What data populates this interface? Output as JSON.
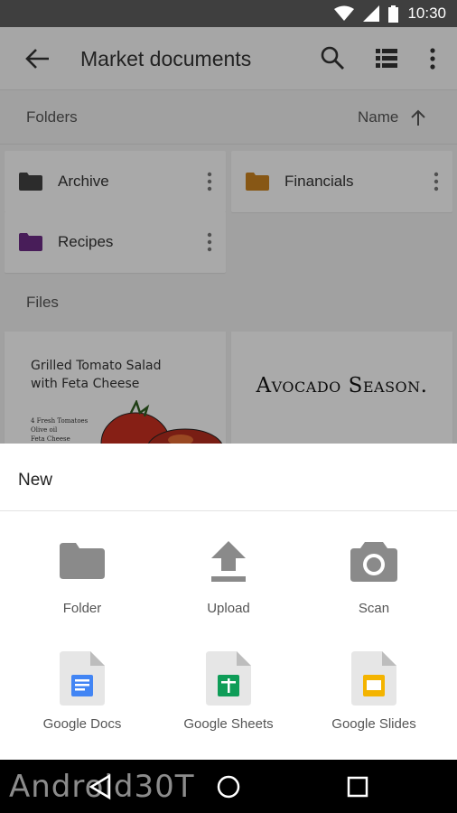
{
  "status_bar": {
    "time": "10:30"
  },
  "app_bar": {
    "title": "Market documents"
  },
  "subheader": {
    "label": "Folders",
    "sort_label": "Name"
  },
  "folders": [
    {
      "name": "Archive",
      "color": "#424242"
    },
    {
      "name": "Financials",
      "color": "#c8811f"
    },
    {
      "name": "Recipes",
      "color": "#6a2b83"
    }
  ],
  "files_label": "Files",
  "files": [
    {
      "title_line1": "Grilled Tomato Salad",
      "title_line2": "with Feta Cheese",
      "ingredients": [
        "4 Fresh Tomatoes",
        "Olive oil",
        "Feta Cheese"
      ]
    },
    {
      "title": "Avocado Season."
    }
  ],
  "sheet": {
    "title": "New",
    "options": [
      {
        "label": "Folder",
        "icon": "folder-icon"
      },
      {
        "label": "Upload",
        "icon": "upload-icon"
      },
      {
        "label": "Scan",
        "icon": "camera-icon"
      },
      {
        "label": "Google Docs",
        "icon": "google-docs-icon"
      },
      {
        "label": "Google Sheets",
        "icon": "google-sheets-icon"
      },
      {
        "label": "Google Slides",
        "icon": "google-slides-icon"
      }
    ]
  },
  "watermark": "Android30T",
  "colors": {
    "docs_blue": "#4285f4",
    "sheets_green": "#0f9d58",
    "slides_yellow": "#f4b400",
    "icon_gray": "#8a8a8a"
  }
}
